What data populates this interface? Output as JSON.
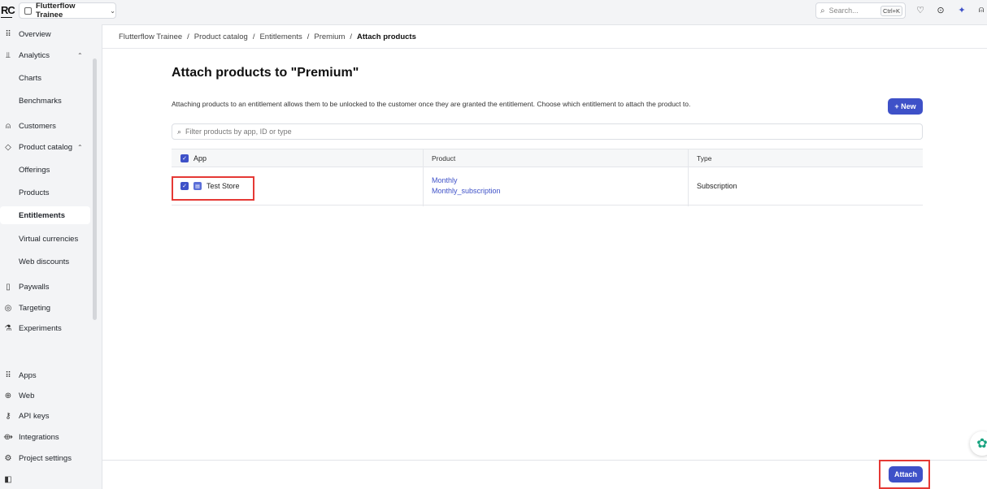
{
  "topbar": {
    "logo": "RC",
    "project_name": "Flutterflow Trainee",
    "search_placeholder": "Search...",
    "search_shortcut": "Ctrl+K"
  },
  "sidebar": {
    "items": [
      {
        "label": "Overview",
        "icon": "grid-icon"
      },
      {
        "label": "Analytics",
        "icon": "chart-icon"
      },
      {
        "label": "Charts"
      },
      {
        "label": "Benchmarks"
      },
      {
        "label": "Customers",
        "icon": "user-icon"
      },
      {
        "label": "Product catalog",
        "icon": "tag-icon"
      },
      {
        "label": "Offerings"
      },
      {
        "label": "Products"
      },
      {
        "label": "Entitlements"
      },
      {
        "label": "Virtual currencies"
      },
      {
        "label": "Web discounts"
      },
      {
        "label": "Paywalls",
        "icon": "phone-icon"
      },
      {
        "label": "Targeting",
        "icon": "target-icon"
      },
      {
        "label": "Experiments",
        "icon": "flask-icon"
      },
      {
        "label": "Apps",
        "icon": "grid-icon"
      },
      {
        "label": "Web",
        "icon": "globe-icon"
      },
      {
        "label": "API keys",
        "icon": "key-icon"
      },
      {
        "label": "Integrations",
        "icon": "plug-icon"
      },
      {
        "label": "Project settings",
        "icon": "gear-icon"
      }
    ]
  },
  "breadcrumb": [
    "Flutterflow Trainee",
    "Product catalog",
    "Entitlements",
    "Premium",
    "Attach products"
  ],
  "page": {
    "title": "Attach products to \"Premium\"",
    "description": "Attaching products to an entitlement allows them to be unlocked to the customer once they are granted the entitlement. Choose which entitlement to attach the product to.",
    "new_label": "+ New",
    "filter_placeholder": "Filter products by app, ID or type",
    "attach_label": "Attach"
  },
  "table": {
    "headers": {
      "app": "App",
      "product": "Product",
      "type": "Type"
    },
    "rows": [
      {
        "app": "Test Store",
        "product_name": "Monthly",
        "product_id": "Monthly_subscription",
        "type": "Subscription"
      }
    ]
  },
  "colors": {
    "accent": "#3e51c8",
    "highlight": "#e53935"
  }
}
